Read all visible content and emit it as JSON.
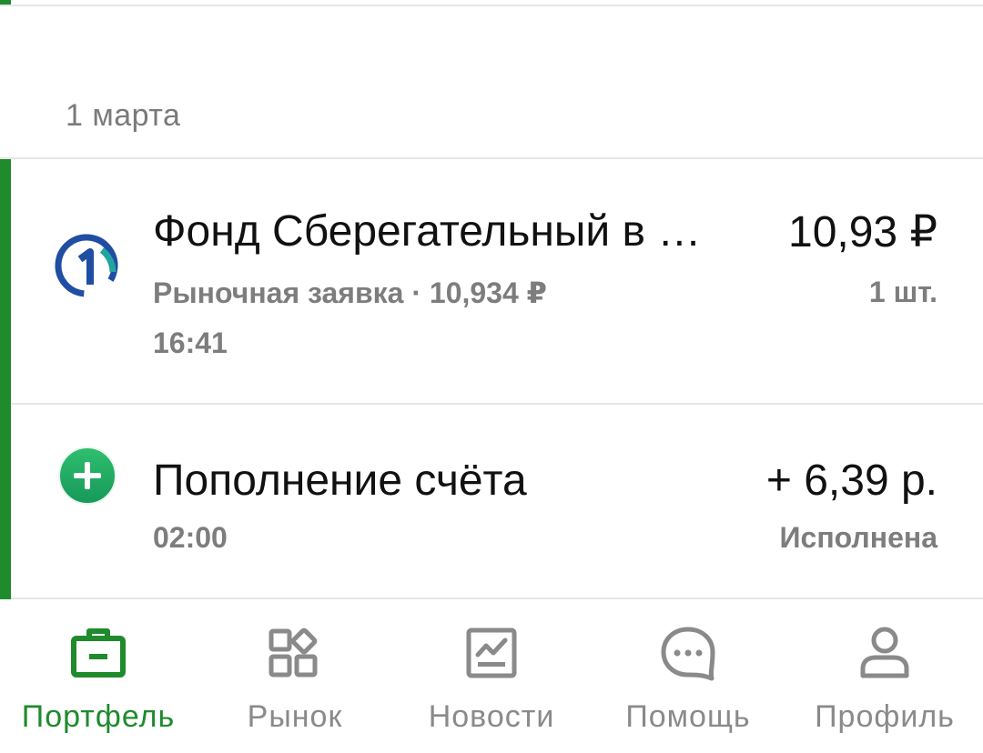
{
  "colors": {
    "accent_green": "#1f8b2c",
    "tab_inactive": "#8a8a8a",
    "secondary_text": "#7d7d7d",
    "deposit_icon_green": "#21a95c",
    "fund_logo_blue": "#1f4ea3"
  },
  "date_header": "1 марта",
  "operations": [
    {
      "icon": "fund-logo-icon",
      "title": "Фонд Сберегательный в …",
      "amount": "10,93 ₽",
      "subtitle": "Рыночная заявка · 10,934 ₽",
      "quantity": "1 шт.",
      "time": "16:41"
    },
    {
      "icon": "plus-circle-icon",
      "title": "Пополнение счёта",
      "amount": "+ 6,39 р.",
      "time": "02:00",
      "status": "Исполнена"
    }
  ],
  "tabbar": {
    "active": "portfolio",
    "tabs": [
      {
        "id": "portfolio",
        "label": "Портфель",
        "icon": "briefcase-icon"
      },
      {
        "id": "market",
        "label": "Рынок",
        "icon": "grid-icon"
      },
      {
        "id": "news",
        "label": "Новости",
        "icon": "chart-icon"
      },
      {
        "id": "help",
        "label": "Помощь",
        "icon": "chat-bubble-icon"
      },
      {
        "id": "profile",
        "label": "Профиль",
        "icon": "user-icon"
      }
    ]
  }
}
